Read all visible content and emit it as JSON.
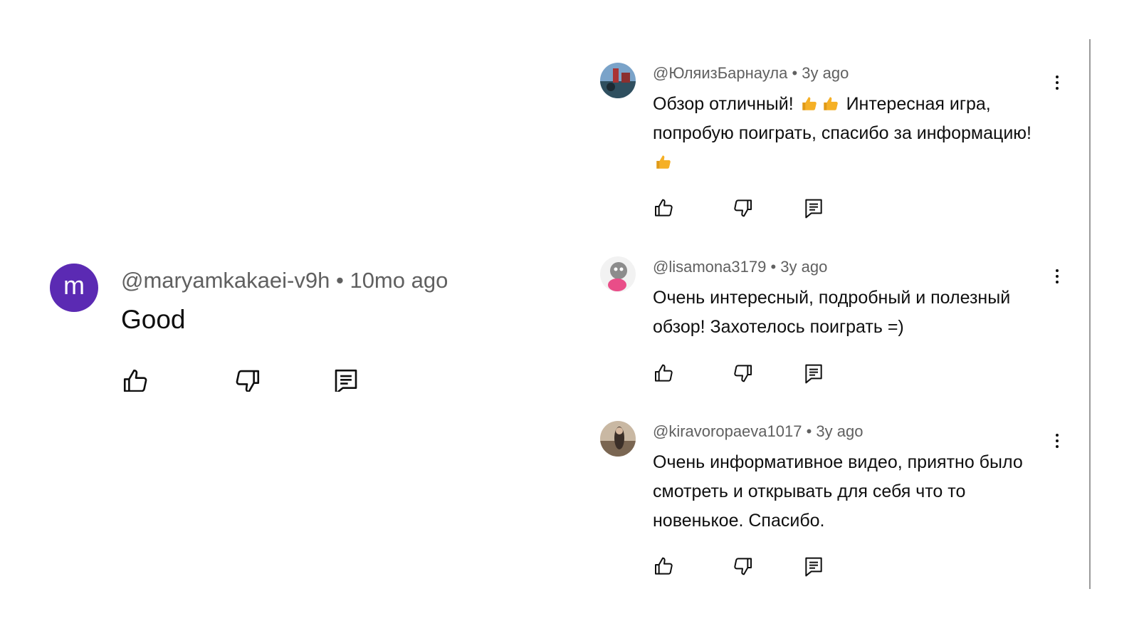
{
  "left_comment": {
    "avatar_letter": "m",
    "avatar_color": "#5b2ab3",
    "author": "@maryamkakaei-v9h",
    "separator": "•",
    "time": "10mo ago",
    "text": "Good"
  },
  "comments": [
    {
      "author": "@ЮляизБарнаула",
      "separator": "•",
      "time": "3y ago",
      "text_parts": [
        "Обзор отличный! ",
        " Интересная игра, попробую поиграть, спасибо за информацию! "
      ],
      "emoji": "thumbs-up-emoji"
    },
    {
      "author": "@lisamona3179",
      "separator": "•",
      "time": "3y ago",
      "text": "Очень интересный, подробный и полезный обзор! Захотелось поиграть =)"
    },
    {
      "author": "@kiravoropaeva1017",
      "separator": "•",
      "time": "3y ago",
      "text": "Очень информативное видео, приятно было смотреть и открывать для себя что то новенькое. Спасибо."
    }
  ],
  "icons": {
    "like": "thumbs-up-icon",
    "dislike": "thumbs-down-icon",
    "reply": "reply-comment-icon",
    "more": "more-vert-icon"
  },
  "colors": {
    "meta_text": "#606060",
    "body_text": "#0f0f0f",
    "emoji": "#f5b026"
  }
}
